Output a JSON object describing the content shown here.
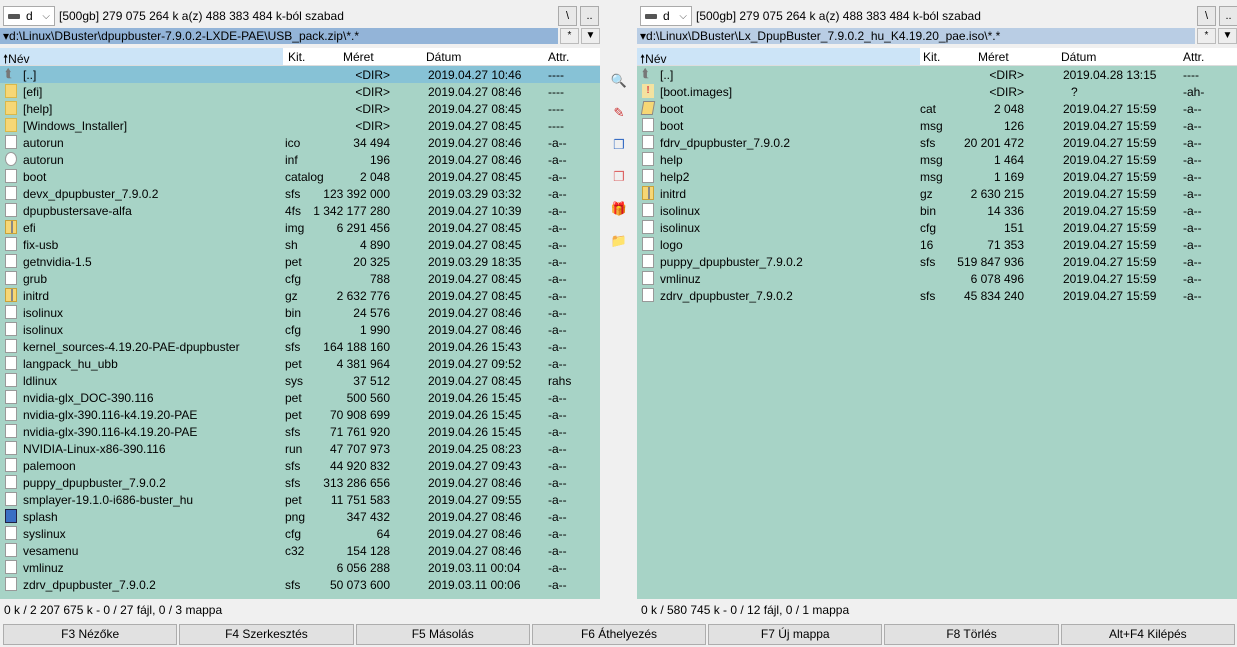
{
  "left": {
    "drive": "d",
    "free": "[500gb]  279 075 264 k a(z) 488 383 484 k-ból szabad",
    "root_btn": "\\",
    "up_btn": "..",
    "path": "d:\\Linux\\DBuster\\dpupbuster-7.9.0.2-LXDE-PAE\\USB_pack.zip\\*.*",
    "filter_btn": "*",
    "hist_btn": "▼",
    "headers": {
      "name": "Név",
      "ext": "Kit.",
      "size": "Méret",
      "date": "Dátum",
      "attr": "Attr."
    },
    "rows": [
      [
        "up",
        "[..]",
        "",
        "<DIR>",
        "2019.04.27 10:46",
        "----"
      ],
      [
        "folder",
        "[efi]",
        "",
        "<DIR>",
        "2019.04.27 08:46",
        "----"
      ],
      [
        "folder",
        "[help]",
        "",
        "<DIR>",
        "2019.04.27 08:45",
        "----"
      ],
      [
        "folder",
        "[Windows_Installer]",
        "",
        "<DIR>",
        "2019.04.27 08:45",
        "----"
      ],
      [
        "file",
        "autorun",
        "ico",
        "34 494",
        "2019.04.27 08:46",
        "-a--"
      ],
      [
        "gear",
        "autorun",
        "inf",
        "196",
        "2019.04.27 08:46",
        "-a--"
      ],
      [
        "file",
        "boot",
        "catalog",
        "2 048",
        "2019.04.27 08:45",
        "-a--"
      ],
      [
        "file",
        "devx_dpupbuster_7.9.0.2",
        "sfs",
        "123 392 000",
        "2019.03.29 03:32",
        "-a--"
      ],
      [
        "file",
        "dpupbustersave-alfa",
        "4fs",
        "1 342 177 280",
        "2019.04.27 10:39",
        "-a--"
      ],
      [
        "zip",
        "efi",
        "img",
        "6 291 456",
        "2019.04.27 08:45",
        "-a--"
      ],
      [
        "file",
        "fix-usb",
        "sh",
        "4 890",
        "2019.04.27 08:45",
        "-a--"
      ],
      [
        "file",
        "getnvidia-1.5",
        "pet",
        "20 325",
        "2019.03.29 18:35",
        "-a--"
      ],
      [
        "file",
        "grub",
        "cfg",
        "788",
        "2019.04.27 08:45",
        "-a--"
      ],
      [
        "zip",
        "initrd",
        "gz",
        "2 632 776",
        "2019.04.27 08:45",
        "-a--"
      ],
      [
        "file",
        "isolinux",
        "bin",
        "24 576",
        "2019.04.27 08:46",
        "-a--"
      ],
      [
        "file",
        "isolinux",
        "cfg",
        "1 990",
        "2019.04.27 08:46",
        "-a--"
      ],
      [
        "file",
        "kernel_sources-4.19.20-PAE-dpupbuster",
        "sfs",
        "164 188 160",
        "2019.04.26 15:43",
        "-a--"
      ],
      [
        "file",
        "langpack_hu_ubb",
        "pet",
        "4 381 964",
        "2019.04.27 09:52",
        "-a--"
      ],
      [
        "file",
        "ldlinux",
        "sys",
        "37 512",
        "2019.04.27 08:45",
        "rahs"
      ],
      [
        "file",
        "nvidia-glx_DOC-390.116",
        "pet",
        "500 560",
        "2019.04.26 15:45",
        "-a--"
      ],
      [
        "file",
        "nvidia-glx-390.116-k4.19.20-PAE",
        "pet",
        "70 908 699",
        "2019.04.26 15:45",
        "-a--"
      ],
      [
        "file",
        "nvidia-glx-390.116-k4.19.20-PAE",
        "sfs",
        "71 761 920",
        "2019.04.26 15:45",
        "-a--"
      ],
      [
        "file",
        "NVIDIA-Linux-x86-390.116",
        "run",
        "47 707 973",
        "2019.04.25 08:23",
        "-a--"
      ],
      [
        "file",
        "palemoon",
        "sfs",
        "44 920 832",
        "2019.04.27 09:43",
        "-a--"
      ],
      [
        "file",
        "puppy_dpupbuster_7.9.0.2",
        "sfs",
        "313 286 656",
        "2019.04.27 08:46",
        "-a--"
      ],
      [
        "file",
        "smplayer-19.1.0-i686-buster_hu",
        "pet",
        "11 751 583",
        "2019.04.27 09:55",
        "-a--"
      ],
      [
        "img",
        "splash",
        "png",
        "347 432",
        "2019.04.27 08:46",
        "-a--"
      ],
      [
        "file",
        "syslinux",
        "cfg",
        "64",
        "2019.04.27 08:46",
        "-a--"
      ],
      [
        "file",
        "vesamenu",
        "c32",
        "154 128",
        "2019.04.27 08:46",
        "-a--"
      ],
      [
        "file",
        "vmlinuz",
        "",
        "6 056 288",
        "2019.03.11 00:04",
        "-a--"
      ],
      [
        "file",
        "zdrv_dpupbuster_7.9.0.2",
        "sfs",
        "50 073 600",
        "2019.03.11 00:06",
        "-a--"
      ]
    ],
    "status": "0 k / 2 207 675 k - 0 / 27 fájl, 0 / 3 mappa"
  },
  "right": {
    "drive": "d",
    "free": "[500gb]  279 075 264 k a(z) 488 383 484 k-ból szabad",
    "root_btn": "\\",
    "up_btn": "..",
    "path": "d:\\Linux\\DBuster\\Lx_DpupBuster_7.9.0.2_hu_K4.19.20_pae.iso\\*.*",
    "filter_btn": "*",
    "hist_btn": "▼",
    "headers": {
      "name": "Név",
      "ext": "Kit.",
      "size": "Méret",
      "date": "Dátum",
      "attr": "Attr."
    },
    "rows": [
      [
        "up",
        "[..]",
        "",
        "<DIR>",
        "2019.04.28 13:15",
        "----"
      ],
      [
        "warn",
        "[boot.images]",
        "",
        "<DIR>",
        "?",
        "-ah-"
      ],
      [
        "cat",
        "boot",
        "cat",
        "2 048",
        "2019.04.27 15:59",
        "-a--"
      ],
      [
        "file",
        "boot",
        "msg",
        "126",
        "2019.04.27 15:59",
        "-a--"
      ],
      [
        "file",
        "fdrv_dpupbuster_7.9.0.2",
        "sfs",
        "20 201 472",
        "2019.04.27 15:59",
        "-a--"
      ],
      [
        "file",
        "help",
        "msg",
        "1 464",
        "2019.04.27 15:59",
        "-a--"
      ],
      [
        "file",
        "help2",
        "msg",
        "1 169",
        "2019.04.27 15:59",
        "-a--"
      ],
      [
        "zip",
        "initrd",
        "gz",
        "2 630 215",
        "2019.04.27 15:59",
        "-a--"
      ],
      [
        "file",
        "isolinux",
        "bin",
        "14 336",
        "2019.04.27 15:59",
        "-a--"
      ],
      [
        "file",
        "isolinux",
        "cfg",
        "151",
        "2019.04.27 15:59",
        "-a--"
      ],
      [
        "file",
        "logo",
        "16",
        "71 353",
        "2019.04.27 15:59",
        "-a--"
      ],
      [
        "file",
        "puppy_dpupbuster_7.9.0.2",
        "sfs",
        "519 847 936",
        "2019.04.27 15:59",
        "-a--"
      ],
      [
        "file",
        "vmlinuz",
        "",
        "6 078 496",
        "2019.04.27 15:59",
        "-a--"
      ],
      [
        "file",
        "zdrv_dpupbuster_7.9.0.2",
        "sfs",
        "45 834 240",
        "2019.04.27 15:59",
        "-a--"
      ]
    ],
    "status": "0 k / 580 745 k - 0 / 12 fájl, 0 / 1 mappa"
  },
  "toolbar_icons": [
    "view-icon",
    "edit-icon",
    "copy-icon",
    "move-icon",
    "pack-icon",
    "new-folder-icon"
  ],
  "fkeys": [
    "F3 Nézőke",
    "F4 Szerkesztés",
    "F5 Másolás",
    "F6 Áthelyezés",
    "F7 Új mappa",
    "F8 Törlés",
    "Alt+F4 Kilépés"
  ],
  "colors": {
    "list_bg": "#a7d3c6",
    "cursor": "#87c2d6",
    "active_path": "#93b4d8",
    "inactive_path": "#b9cde4"
  }
}
